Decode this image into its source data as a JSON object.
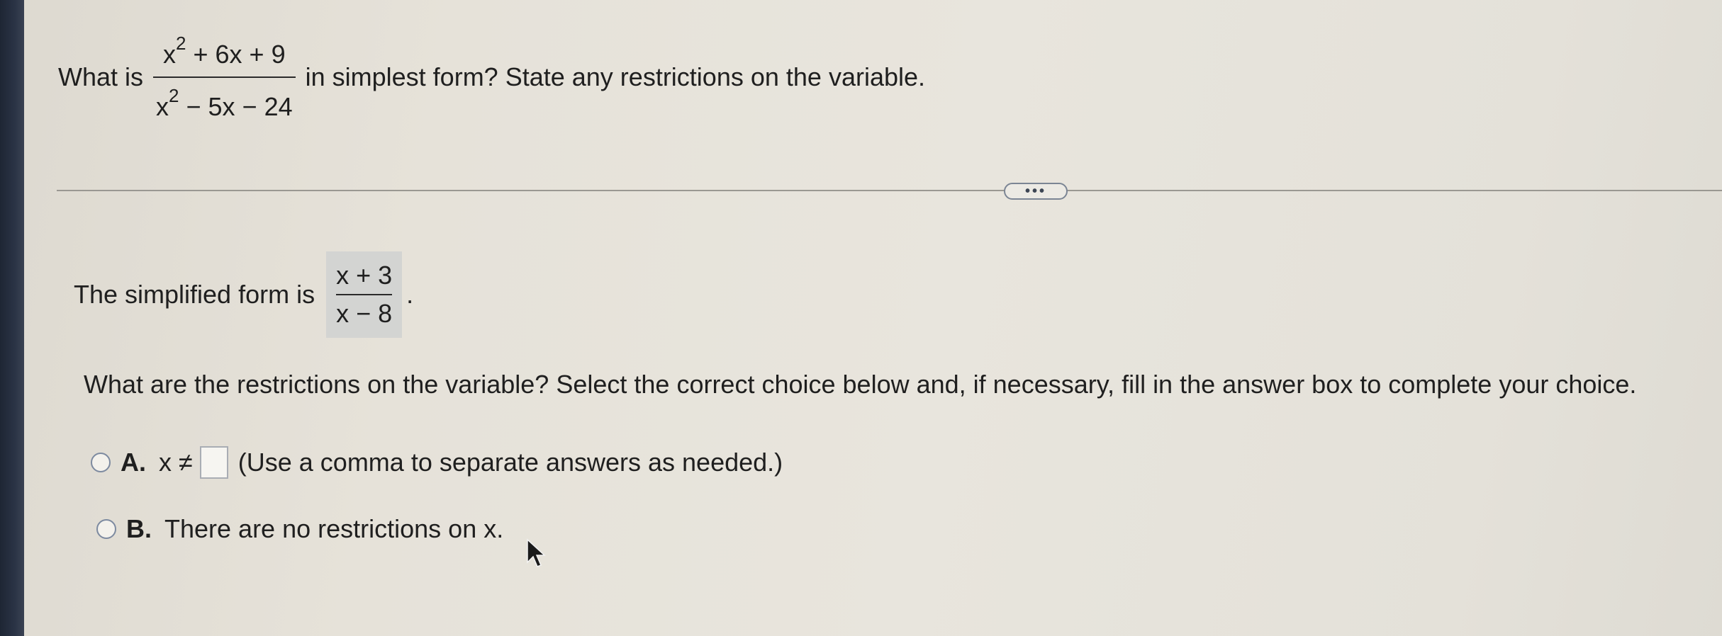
{
  "question": {
    "prefix": "What is",
    "numerator_base": "x",
    "numerator_exp": "2",
    "numerator_rest": " + 6x + 9",
    "denominator_base": "x",
    "denominator_exp": "2",
    "denominator_rest": " − 5x − 24",
    "suffix": "in simplest form? State any restrictions on the variable."
  },
  "more_button": {
    "label": "•••"
  },
  "answer": {
    "prefix": "The simplified form is",
    "numerator": "x + 3",
    "denominator": "x − 8",
    "suffix": "."
  },
  "restrictions_prompt": "What are the restrictions on the variable? Select the correct choice below and, if necessary, fill in the answer box to complete your choice.",
  "choices": [
    {
      "letter": "A.",
      "expression": "x ≠",
      "input_value": "",
      "note": "(Use a comma to separate answers as needed.)"
    },
    {
      "letter": "B.",
      "text": "There are no restrictions on x."
    }
  ],
  "colors": {
    "radio_border": "#7d8aa0",
    "answer_highlight": "#d3d4d2",
    "left_edge": "#1e2634"
  }
}
